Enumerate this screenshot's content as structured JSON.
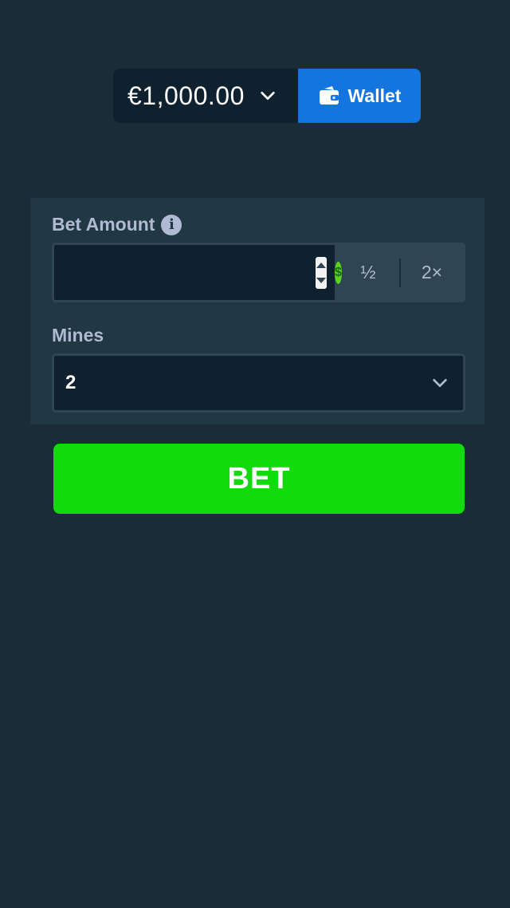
{
  "header": {
    "balance": "€1,000.00",
    "wallet_label": "Wallet"
  },
  "bet_form": {
    "bet_amount_label": "Bet Amount",
    "bet_amount_value": "",
    "currency_icon": "dollar-coin-icon",
    "half_label": "½",
    "double_label": "2×",
    "mines_label": "Mines",
    "mines_value": "2"
  },
  "actions": {
    "bet_label": "BET"
  },
  "colors": {
    "background": "#1a2c38",
    "panel": "#213743",
    "input": "#0f212e",
    "wallet_button": "#1475e1",
    "bet_button": "#11db0b",
    "coin": "#5cd21c"
  }
}
